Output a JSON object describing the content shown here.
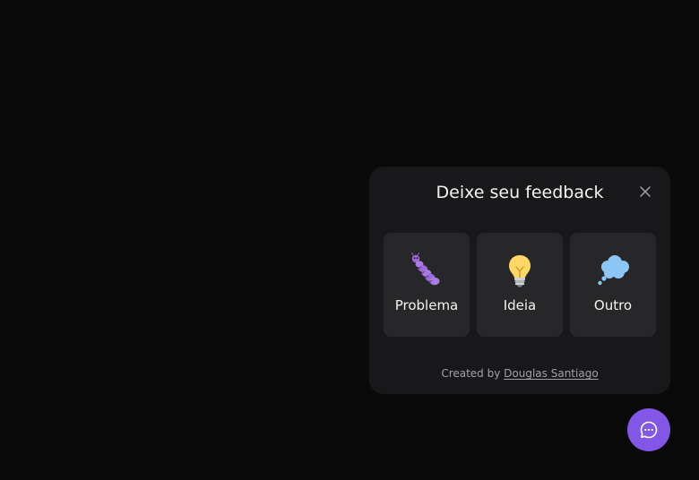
{
  "widget": {
    "title": "Deixe seu feedback",
    "close_icon": "close-icon",
    "options": [
      {
        "label": "Problema",
        "icon": "bug-icon"
      },
      {
        "label": "Ideia",
        "icon": "lightbulb-icon"
      },
      {
        "label": "Outro",
        "icon": "thought-bubble-icon"
      }
    ],
    "footer": {
      "prefix": "Created by",
      "author": "Douglas Santiago"
    }
  },
  "fab": {
    "icon": "chat-bubble-icon",
    "color": "#8257e5"
  },
  "colors": {
    "background": "#09090a",
    "card": "#18181b",
    "option": "#27272a",
    "accent": "#8257e5"
  }
}
